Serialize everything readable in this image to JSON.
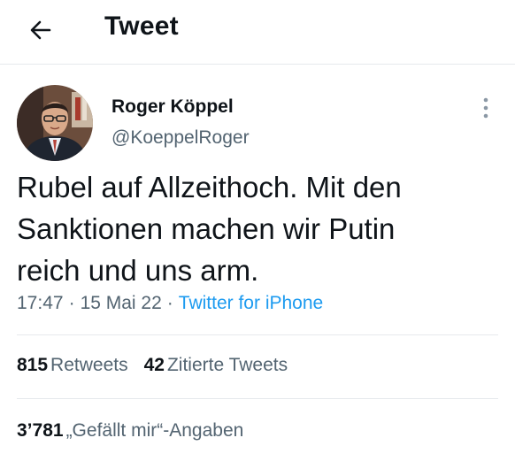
{
  "header": {
    "back_icon": "arrow-left-icon",
    "title": "Tweet"
  },
  "author": {
    "name": "Roger Köppel",
    "handle": "@KoeppelRoger",
    "avatar_icon": "profile-photo"
  },
  "tweet": {
    "lines": [
      "Rubel auf Allzeithoch. Mit den",
      "Sanktionen machen wir Putin",
      "reich und uns arm."
    ],
    "time": "17:47",
    "date": "15 Mai 22",
    "separator": "·",
    "source": "Twitter for iPhone"
  },
  "stats": {
    "retweets_count": "815",
    "retweets_label": "Retweets",
    "quotes_count": "42",
    "quotes_label": "Zitierte Tweets",
    "likes_count": "3’781",
    "likes_label": "„Gefällt mir“-Angaben"
  },
  "colors": {
    "text": "#0f1419",
    "secondary": "#536471",
    "accent": "#1d9bf0",
    "divider": "#e6e9ec"
  }
}
